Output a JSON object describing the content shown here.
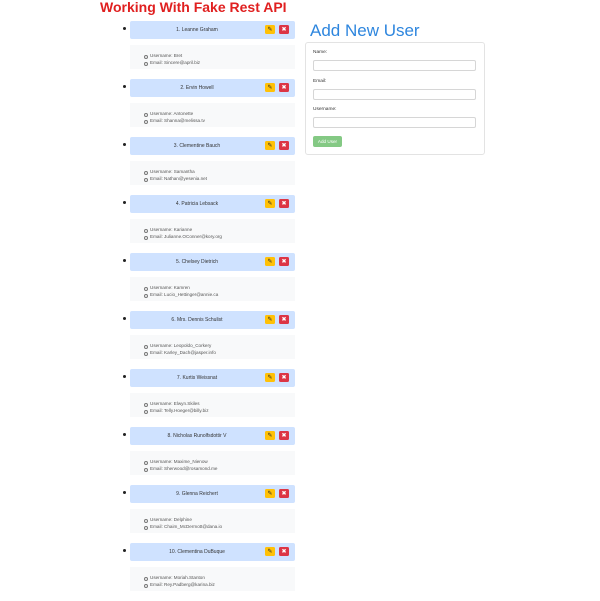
{
  "app_title": "Working With Fake Rest API",
  "users": [
    {
      "name": "1. Leanne Graham",
      "username_line": "Username: Bret",
      "email_line": "Email: Sincere@april.biz"
    },
    {
      "name": "2. Ervin Howell",
      "username_line": "Username: Antonette",
      "email_line": "Email: Shanna@melissa.tv"
    },
    {
      "name": "3. Clementine Bauch",
      "username_line": "Username: Samantha",
      "email_line": "Email: Nathan@yesenia.net"
    },
    {
      "name": "4. Patricia Lebsack",
      "username_line": "Username: Karianne",
      "email_line": "Email: Julianne.OConner@kory.org"
    },
    {
      "name": "5. Chelsey Dietrich",
      "username_line": "Username: Kamren",
      "email_line": "Email: Lucio_Hettinger@annie.ca"
    },
    {
      "name": "6. Mrs. Dennis Schulist",
      "username_line": "Username: Leopoldo_Corkery",
      "email_line": "Email: Karley_Dach@jasper.info"
    },
    {
      "name": "7. Kurtis Weissnat",
      "username_line": "Username: Elwyn.Skiles",
      "email_line": "Email: Telly.Hoeger@billy.biz"
    },
    {
      "name": "8. Nicholas Runolfsdottir V",
      "username_line": "Username: Maxime_Nienow",
      "email_line": "Email: Sherwood@rosamond.me"
    },
    {
      "name": "9. Glenna Reichert",
      "username_line": "Username: Delphine",
      "email_line": "Email: Chaim_McDermott@dana.io"
    },
    {
      "name": "10. Clementina DuBuque",
      "username_line": "Username: Moriah.Stanton",
      "email_line": "Email: Rey.Padberg@karina.biz"
    }
  ],
  "icons": {
    "edit": "pencil-icon",
    "delete": "close-icon"
  },
  "form": {
    "heading": "Add New User",
    "name_label": "Name:",
    "email_label": "Email:",
    "username_label": "Username:",
    "name_value": "",
    "email_value": "",
    "username_value": "",
    "submit_label": "Add User"
  },
  "colors": {
    "title": "#e02020",
    "header_bg": "#cfe2ff",
    "edit_button": "#ffc107",
    "delete_button": "#dc3545",
    "heading": "#2e86de",
    "submit_button": "#5cb85c"
  }
}
